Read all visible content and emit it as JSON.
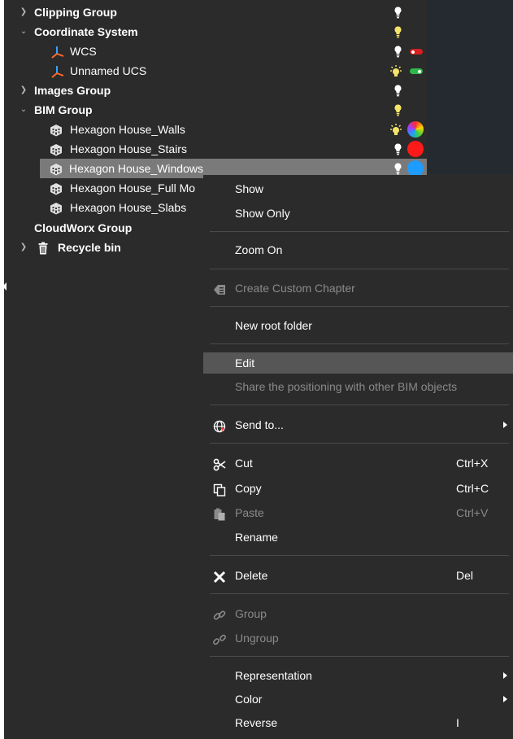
{
  "tree": {
    "rows": [
      {
        "label": "Clipping Group",
        "expanded": false
      },
      {
        "label": "Coordinate System",
        "expanded": true
      },
      {
        "label": "WCS"
      },
      {
        "label": "Unnamed UCS"
      },
      {
        "label": "Images Group",
        "expanded": false
      },
      {
        "label": "BIM Group",
        "expanded": true
      },
      {
        "label": "Hexagon House_Walls"
      },
      {
        "label": "Hexagon House_Stairs"
      },
      {
        "label": "Hexagon House_Windows",
        "selected": true
      },
      {
        "label": "Hexagon House_Full Mo"
      },
      {
        "label": "Hexagon House_Slabs"
      },
      {
        "label": "CloudWorx Group"
      },
      {
        "label": "Recycle bin",
        "expanded": false
      }
    ],
    "colors": {
      "bulb_yellow": "#f4e46a",
      "bulb_white": "#ffffff",
      "toggle_red": "#d81e1e",
      "toggle_green": "#2eb84a",
      "stairs_color": "#ff1a1a",
      "windows_color": "#1e9cff",
      "ucs_axis_red": "#ff6a2a",
      "ucs_axis_blue": "#3aa0ff"
    }
  },
  "menu": {
    "items": [
      {
        "label": "Show"
      },
      {
        "label": "Show Only"
      },
      {
        "label": "Zoom On"
      },
      {
        "label": "Create Custom Chapter",
        "disabled": true,
        "icon": "chapter-icon"
      },
      {
        "label": "New root folder"
      },
      {
        "label": "Edit",
        "highlighted": true
      },
      {
        "label": "Share the positioning with other BIM objects",
        "disabled": true
      },
      {
        "label": "Send to...",
        "icon": "globe-icon",
        "submenu": true
      },
      {
        "label": "Cut",
        "shortcut": "Ctrl+X",
        "icon": "scissors-icon"
      },
      {
        "label": "Copy",
        "shortcut": "Ctrl+C",
        "icon": "copy-icon"
      },
      {
        "label": "Paste",
        "shortcut": "Ctrl+V",
        "disabled": true,
        "icon": "paste-icon"
      },
      {
        "label": "Rename"
      },
      {
        "label": "Delete",
        "shortcut": "Del",
        "icon": "delete-x-icon"
      },
      {
        "label": "Group",
        "disabled": true,
        "icon": "link-icon"
      },
      {
        "label": "Ungroup",
        "disabled": true,
        "icon": "unlink-icon"
      },
      {
        "label": "Representation",
        "submenu": true
      },
      {
        "label": "Color",
        "submenu": true
      },
      {
        "label": "Reverse",
        "shortcut": "I"
      }
    ]
  }
}
